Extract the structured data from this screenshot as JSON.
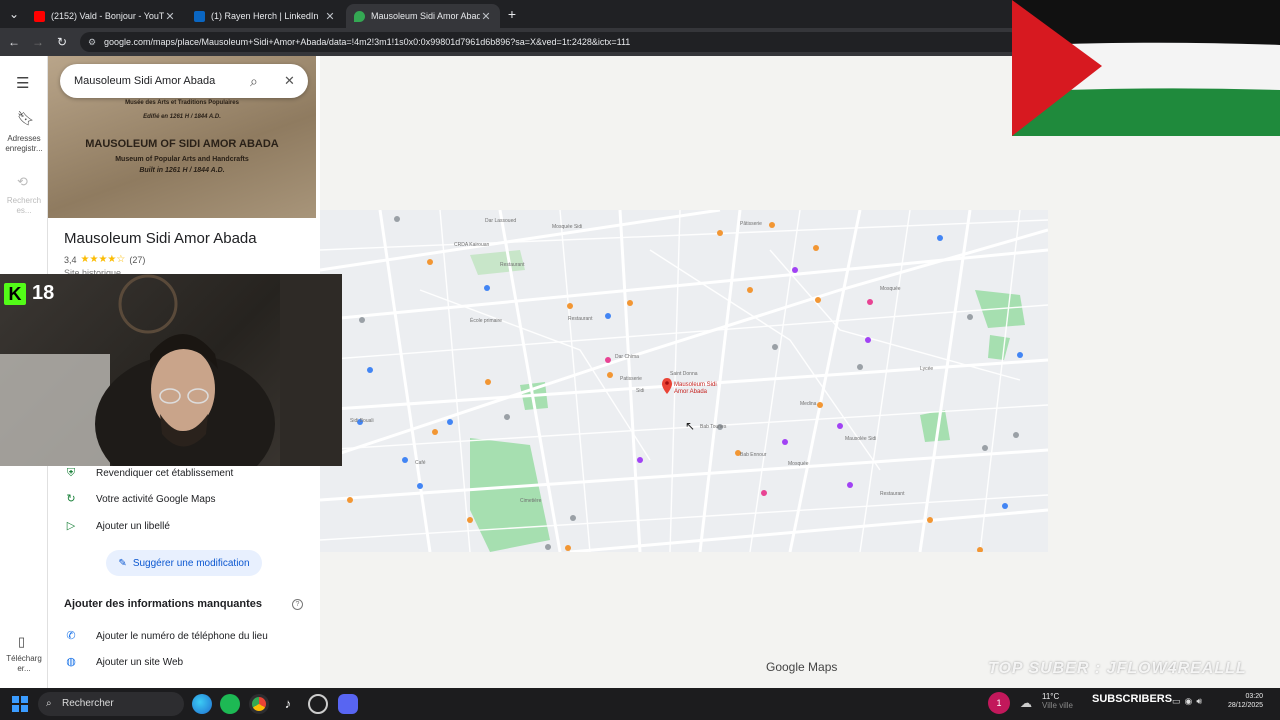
{
  "browser": {
    "tabs": [
      {
        "title": "(2152) Vald - Bonjour - YouTube",
        "icon_color": "#ff0000"
      },
      {
        "title": "(1) Rayen Herch | LinkedIn",
        "icon_color": "#0a66c2"
      },
      {
        "title": "Mausoleum Sidi Amor Abada -",
        "icon_color": "#34a853"
      }
    ],
    "new_tab_label": "+",
    "url": "google.com/maps/place/Mausoleum+Sidi+Amor+Abada/data=!4m2!3m1!1s0x0:0x99801d7961d6b896?sa=X&ved=1t:2428&ictx=111"
  },
  "rail": {
    "saved_label": "Adresses enregistr...",
    "recent_label": "Recherch es...",
    "download_label": "Télécharg er..."
  },
  "panel": {
    "search_value": "Mausoleum Sidi Amor Abada",
    "hero_plaque": {
      "line1": "Musée des Arts et Traditions Populaires",
      "line2": "Edifié en 1261 H / 1844 A.D.",
      "line3": "MAUSOLEUM OF SIDI AMOR ABADA",
      "line4": "Museum of Popular Arts and Handcrafts",
      "line5": "Built in 1261 H / 1844 A.D."
    },
    "place_title": "Mausoleum Sidi Amor Abada",
    "rating_value": "3,4",
    "rating_stars": "★★★★☆",
    "rating_count": "(27)",
    "category": "Site historique",
    "actions": [
      {
        "label": "Revendiquer cet établissement",
        "icon": "shield-check-icon",
        "glyph": "⛨"
      },
      {
        "label": "Votre activité Google Maps",
        "icon": "history-icon",
        "glyph": "↻"
      },
      {
        "label": "Ajouter un libellé",
        "icon": "label-icon",
        "glyph": "▷"
      }
    ],
    "suggest_label": "Suggérer une modification",
    "missing_title": "Ajouter des informations manquantes",
    "missing_items": [
      {
        "label": "Ajouter le numéro de téléphone du lieu",
        "icon": "phone-icon",
        "glyph": "✆"
      },
      {
        "label": "Ajouter un site Web",
        "icon": "globe-icon",
        "glyph": "◍"
      }
    ]
  },
  "map": {
    "pin_label": "Mausoleum Sidi Amor Abada",
    "logo": "Google Maps"
  },
  "overlay": {
    "kick_count": "18",
    "top_suber_text": "TOP SUBER : JFLOW4REALLL",
    "subscribers_label": "SUBSCRIBERS"
  },
  "taskbar": {
    "search_label": "Rechercher",
    "weather_temp": "11°C",
    "weather_place": "Ville ville",
    "time": "03:20",
    "date": "28/12/2025",
    "notif_count": "1"
  }
}
